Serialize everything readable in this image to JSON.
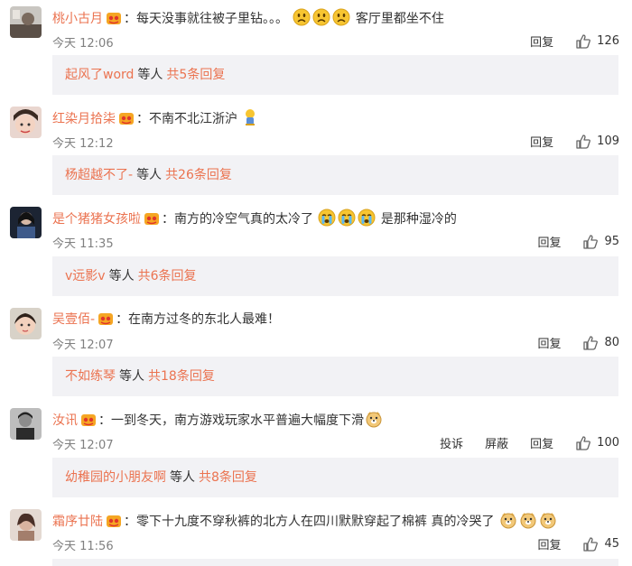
{
  "comments": [
    {
      "username": "桃小古月",
      "text_before": "：每天没事就往被子里钻。。。",
      "emoji_count": 3,
      "emoji_type": "frown",
      "text_after": "客厅里都坐不住",
      "time": "今天 12:06",
      "reply_label": "回复",
      "likes": "126",
      "reply_thread": {
        "user": "起风了word",
        "middle": "等人",
        "count_text": "共5条回复"
      }
    },
    {
      "username": "红染月拾柒",
      "text_before": "：不南不北江浙沪",
      "emoji_count": 1,
      "emoji_type": "figure",
      "text_after": "",
      "time": "今天 12:12",
      "reply_label": "回复",
      "likes": "109",
      "reply_thread": {
        "user": "杨超越不了-",
        "middle": "等人",
        "count_text": "共26条回复"
      }
    },
    {
      "username": "是个猪猪女孩啦",
      "text_before": "：南方的冷空气真的太冷了",
      "emoji_count": 3,
      "emoji_type": "cry",
      "text_after": "是那种湿冷的",
      "time": "今天 11:35",
      "reply_label": "回复",
      "likes": "95",
      "reply_thread": {
        "user": "v远影v",
        "middle": "等人",
        "count_text": "共6条回复"
      }
    },
    {
      "username": "吴壹佰-",
      "text_before": "：在南方过冬的东北人最难！",
      "emoji_count": 0,
      "emoji_type": "",
      "text_after": "",
      "time": "今天 12:07",
      "reply_label": "回复",
      "likes": "80",
      "reply_thread": {
        "user": "不如练琴",
        "middle": "等人",
        "count_text": "共18条回复"
      }
    },
    {
      "username": "汝讯",
      "text_before": "：一到冬天，南方游戏玩家水平普遍大幅度下滑",
      "emoji_count": 1,
      "emoji_type": "doge",
      "text_after": "",
      "time": "今天 12:07",
      "report_label": "投诉",
      "block_label": "屏蔽",
      "reply_label": "回复",
      "likes": "100",
      "reply_thread": {
        "user": "幼稚园的小朋友啊",
        "middle": "等人",
        "count_text": "共8条回复"
      }
    },
    {
      "username": "霜序廿陆",
      "text_before": "：零下十九度不穿秋裤的北方人在四川默默穿起了棉裤 真的冷哭了",
      "emoji_count": 3,
      "emoji_type": "doge",
      "text_after": "",
      "time": "今天 11:56",
      "reply_label": "回复",
      "likes": "45"
    }
  ],
  "colors": {
    "username": "#eb7350",
    "reply_bg": "#f2f2f5",
    "time": "#808080",
    "emoji": "#f7c531"
  }
}
